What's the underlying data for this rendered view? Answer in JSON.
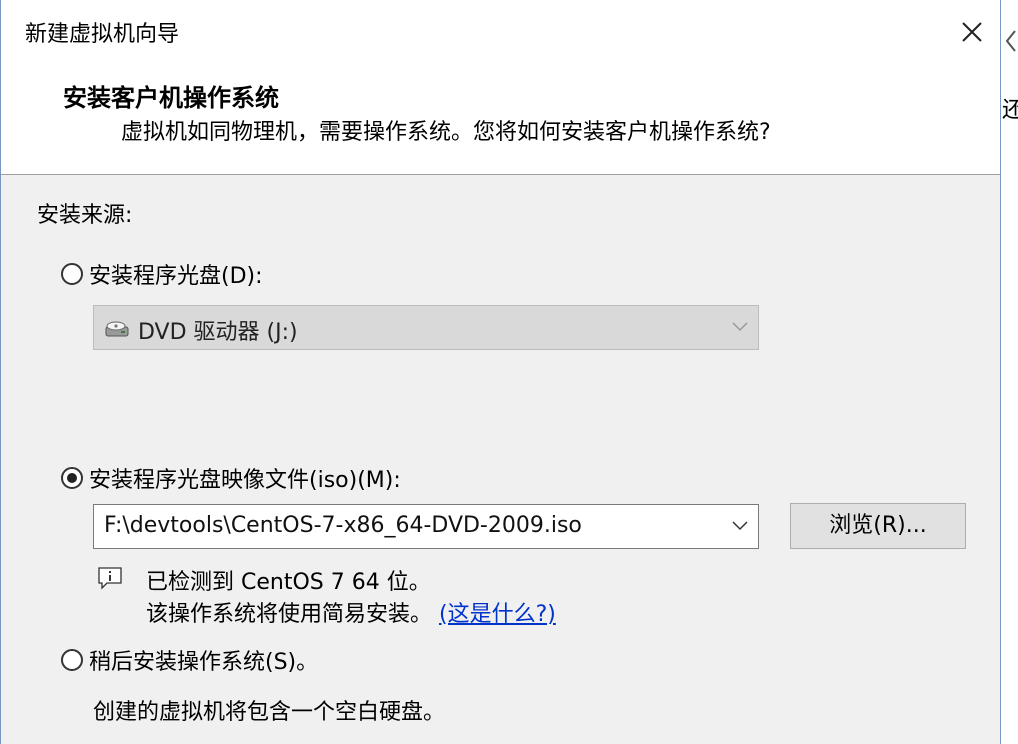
{
  "window": {
    "title": "新建虚拟机向导"
  },
  "header": {
    "title": "安装客户机操作系统",
    "subtitle": "虚拟机如同物理机，需要操作系统。您将如何安装客户机操作系统?"
  },
  "install_source": {
    "label": "安装来源:",
    "options": [
      {
        "label": "安装程序光盘(D):",
        "selected": false
      },
      {
        "label": "安装程序光盘映像文件(iso)(M):",
        "selected": true
      },
      {
        "label": "稍后安装操作系统(S)。",
        "selected": false
      }
    ],
    "dvd_drive": {
      "value": "DVD 驱动器 (J:)",
      "icon": "dvd-drive-icon",
      "disabled": true
    },
    "iso_path": {
      "value": "F:\\devtools\\CentOS-7-x86_64-DVD-2009.iso"
    },
    "browse_label": "浏览(R)...",
    "detected_text": "已检测到 CentOS 7 64 位。",
    "easy_install_text": "该操作系统将使用简易安装。",
    "whats_this_link": "(这是什么?)",
    "later_description": "创建的虚拟机将包含一个空白硬盘。"
  },
  "side_panel": {
    "text": "还"
  }
}
